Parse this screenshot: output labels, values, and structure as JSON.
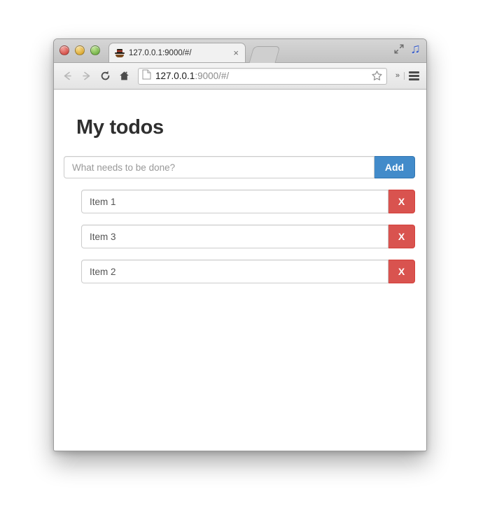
{
  "window": {
    "traffic_lights": [
      "close",
      "minimize",
      "maximize"
    ],
    "expand_icon": "expand-arrows-icon",
    "music_icon": "music-note-icon"
  },
  "tab": {
    "favicon": "hat-mustache-icon",
    "title": "127.0.0.1:9000/#/",
    "close_label": "×",
    "newtab_label": "+"
  },
  "toolbar": {
    "back_icon": "back-arrow-icon",
    "forward_icon": "forward-arrow-icon",
    "reload_icon": "reload-icon",
    "home_icon": "home-icon",
    "page_icon": "page-document-icon",
    "url_host": "127.0.0.1",
    "url_rest": ":9000/#/",
    "star_icon": "bookmark-star-icon",
    "overflow_label": "»",
    "menu_icon": "hamburger-menu-icon"
  },
  "page": {
    "title": "My todos",
    "add": {
      "placeholder": "What needs to be done?",
      "value": "",
      "button_label": "Add"
    },
    "todos": [
      {
        "text": "Item 1",
        "delete_label": "X"
      },
      {
        "text": "Item 3",
        "delete_label": "X"
      },
      {
        "text": "Item 2",
        "delete_label": "X"
      }
    ]
  },
  "colors": {
    "primary_blue": "#428bca",
    "danger_red": "#d9534f",
    "title_dark": "#2f2f2f",
    "placeholder_gray": "#999999",
    "url_dim_gray": "#8c8c8c"
  }
}
